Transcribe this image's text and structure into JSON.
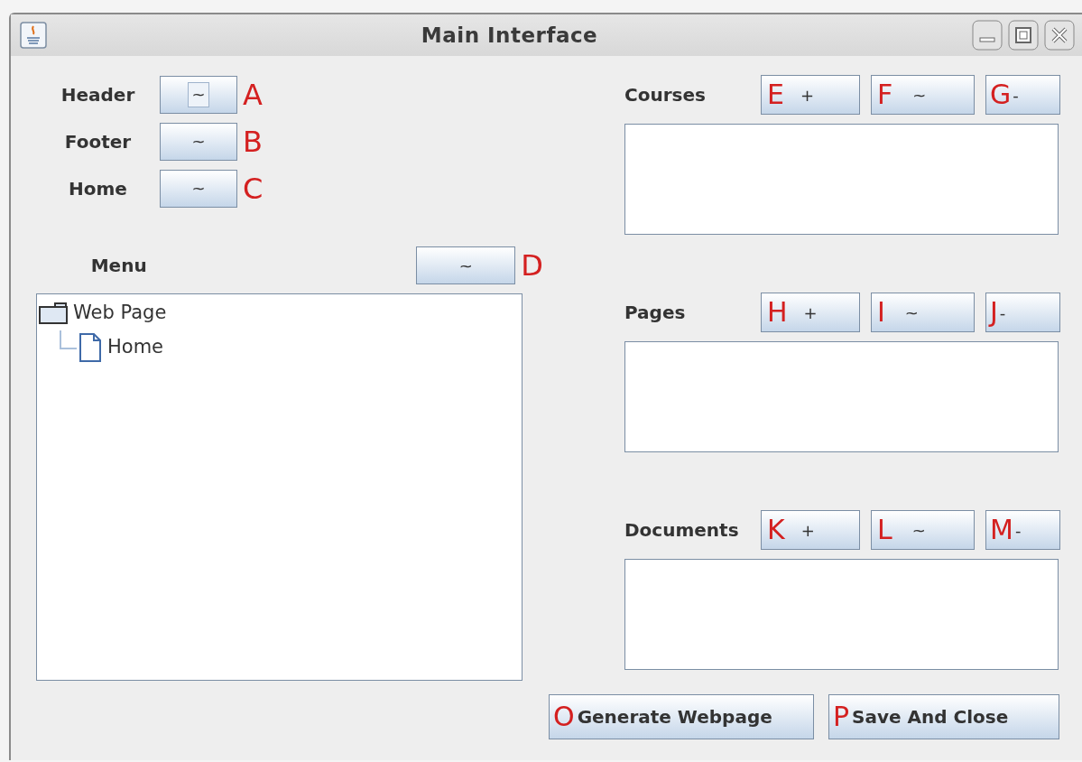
{
  "window": {
    "title": "Main Interface"
  },
  "fields": [
    {
      "label": "Header",
      "button": "~",
      "marker": "A",
      "focused": true
    },
    {
      "label": "Footer",
      "button": "~",
      "marker": "B",
      "focused": false
    },
    {
      "label": "Home",
      "button": "~",
      "marker": "C",
      "focused": false
    }
  ],
  "menu": {
    "label": "Menu",
    "button": "~",
    "marker": "D",
    "tree": [
      {
        "label": "Web Page",
        "kind": "folder",
        "children": [
          {
            "label": "Home",
            "kind": "page"
          }
        ]
      }
    ]
  },
  "sections": [
    {
      "label": "Courses",
      "buttons": [
        {
          "marker": "E",
          "label": "+"
        },
        {
          "marker": "F",
          "label": "~"
        },
        {
          "marker": "G",
          "label": "-"
        }
      ]
    },
    {
      "label": "Pages",
      "buttons": [
        {
          "marker": "H",
          "label": "+"
        },
        {
          "marker": "I",
          "label": "~"
        },
        {
          "marker": "J",
          "label": "-"
        }
      ]
    },
    {
      "label": "Documents",
      "buttons": [
        {
          "marker": "K",
          "label": "+"
        },
        {
          "marker": "L",
          "label": "~"
        },
        {
          "marker": "M",
          "label": "-"
        }
      ]
    }
  ],
  "actions": [
    {
      "marker": "O",
      "label": "Generate Webpage"
    },
    {
      "marker": "P",
      "label": "Save And Close"
    }
  ]
}
